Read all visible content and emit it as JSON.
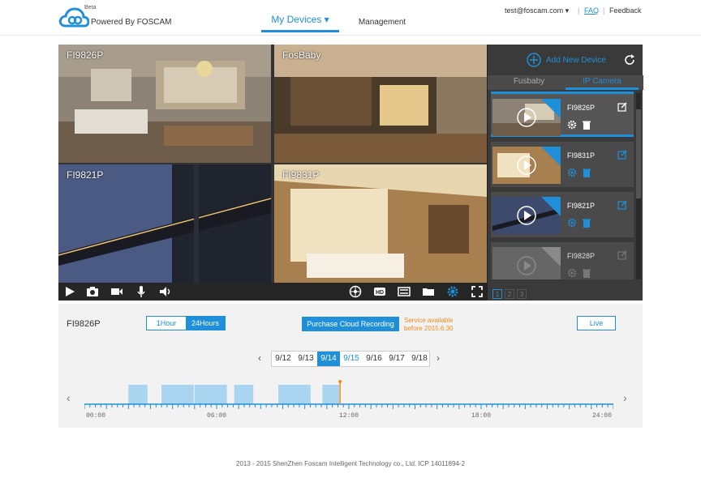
{
  "header": {
    "beta": "Beta",
    "powered": "Powered By FOSCAM",
    "nav_devices": "My Devices ▾",
    "nav_management": "Management",
    "user_email": "test@foscam.com ▾",
    "faq": "FAQ",
    "feedback": "Feedback"
  },
  "grid": {
    "tiles": [
      {
        "label": "FI9826P"
      },
      {
        "label": "FosBaby"
      },
      {
        "label": "FI9821P"
      },
      {
        "label": "FI9831P"
      }
    ]
  },
  "sidebar": {
    "add_device": "Add New Device",
    "tabs": [
      "Fusbaby",
      "IP Camera"
    ],
    "devices": [
      {
        "name": "FI9826P",
        "status": "Online"
      },
      {
        "name": "FI9831P",
        "status": "Online"
      },
      {
        "name": "FI9821P",
        "status": "Online"
      },
      {
        "name": "FI9828P",
        "status": "Offline"
      }
    ],
    "pages": [
      "1",
      "2",
      "3"
    ]
  },
  "playback": {
    "camera": "FI9826P",
    "range_1h": "1Hour",
    "range_24h": "24Hours",
    "purchase": "Purchase Cloud Recording",
    "service_line1": "Service available",
    "service_line2": "before 2015.6.30",
    "live": "Live",
    "dates": [
      "9/12",
      "9/13",
      "9/14",
      "9/15",
      "9/16",
      "9/17",
      "9/18"
    ],
    "selected_date": "9/14",
    "time_labels": [
      "00:00",
      "06:00",
      "12:00",
      "18:00",
      "24:00"
    ],
    "recordings_hours": [
      [
        2.0,
        2.9
      ],
      [
        3.5,
        5.0
      ],
      [
        5.0,
        6.5
      ],
      [
        6.8,
        7.7
      ],
      [
        8.8,
        10.3
      ],
      [
        10.8,
        11.6
      ]
    ],
    "current_hour": 11.6
  },
  "footer": "2013 - 2015 ShenZhen Foscam Intelligent Technology co., Ltd.   ICP 14011894-2"
}
